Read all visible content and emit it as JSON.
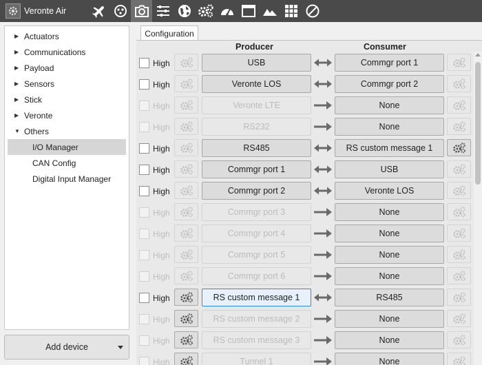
{
  "app": {
    "title": "Veronte Air",
    "toolbar_icons": [
      "plane-icon",
      "joystick-icon",
      "camera-icon",
      "sliders-icon",
      "globe-icon",
      "gears-icon",
      "gauge-icon",
      "window-icon",
      "terrain-icon",
      "grid-icon",
      "disabled-icon"
    ],
    "active_icon": "camera-icon"
  },
  "sidebar": {
    "items": [
      {
        "label": "Actuators",
        "expanded": false
      },
      {
        "label": "Communications",
        "expanded": false
      },
      {
        "label": "Payload",
        "expanded": false
      },
      {
        "label": "Sensors",
        "expanded": false
      },
      {
        "label": "Stick",
        "expanded": false
      },
      {
        "label": "Veronte",
        "expanded": false
      },
      {
        "label": "Others",
        "expanded": true
      }
    ],
    "children": [
      {
        "label": "I/O Manager",
        "selected": true
      },
      {
        "label": "CAN Config",
        "selected": false
      },
      {
        "label": "Digital Input Manager",
        "selected": false
      }
    ],
    "add_device_label": "Add device"
  },
  "tab": {
    "label": "Configuration"
  },
  "table": {
    "producer_header": "Producer",
    "consumer_header": "Consumer",
    "high_label": "High",
    "rows": [
      {
        "producer": "USB",
        "consumer": "Commgr port 1",
        "enabled": true,
        "bidir": true,
        "pgear": false,
        "cgear": false
      },
      {
        "producer": "Veronte LOS",
        "consumer": "Commgr port 2",
        "enabled": true,
        "bidir": true,
        "pgear": false,
        "cgear": false
      },
      {
        "producer": "Veronte LTE",
        "consumer": "None",
        "enabled": false,
        "bidir": false,
        "pgear": false,
        "cgear": false
      },
      {
        "producer": "RS232",
        "consumer": "None",
        "enabled": false,
        "bidir": false,
        "pgear": false,
        "cgear": false
      },
      {
        "producer": "RS485",
        "consumer": "RS custom message 1",
        "enabled": true,
        "bidir": true,
        "pgear": false,
        "cgear": true
      },
      {
        "producer": "Commgr port 1",
        "consumer": "USB",
        "enabled": true,
        "bidir": true,
        "pgear": false,
        "cgear": false
      },
      {
        "producer": "Commgr port 2",
        "consumer": "Veronte LOS",
        "enabled": true,
        "bidir": true,
        "pgear": false,
        "cgear": false
      },
      {
        "producer": "Commgr port 3",
        "consumer": "None",
        "enabled": false,
        "bidir": false,
        "pgear": false,
        "cgear": false
      },
      {
        "producer": "Commgr port 4",
        "consumer": "None",
        "enabled": false,
        "bidir": false,
        "pgear": false,
        "cgear": false
      },
      {
        "producer": "Commgr port 5",
        "consumer": "None",
        "enabled": false,
        "bidir": false,
        "pgear": false,
        "cgear": false
      },
      {
        "producer": "Commgr port 6",
        "consumer": "None",
        "enabled": false,
        "bidir": false,
        "pgear": false,
        "cgear": false
      },
      {
        "producer": "RS custom message 1",
        "consumer": "RS485",
        "enabled": true,
        "bidir": true,
        "pgear": true,
        "cgear": false,
        "focused": true
      },
      {
        "producer": "RS custom message 2",
        "consumer": "None",
        "enabled": false,
        "bidir": false,
        "pgear": true,
        "cgear": false
      },
      {
        "producer": "RS custom message 3",
        "consumer": "None",
        "enabled": false,
        "bidir": false,
        "pgear": true,
        "cgear": false
      },
      {
        "producer": "Tunnel 1",
        "consumer": "None",
        "enabled": false,
        "bidir": false,
        "pgear": true,
        "cgear": false
      }
    ]
  },
  "colors": {
    "toolbar_bg": "#4a4a4a",
    "active_icon_bg": "#6f6f6f",
    "focus_border": "#2b8fd6",
    "arrow_color": "#6a6a6a"
  }
}
